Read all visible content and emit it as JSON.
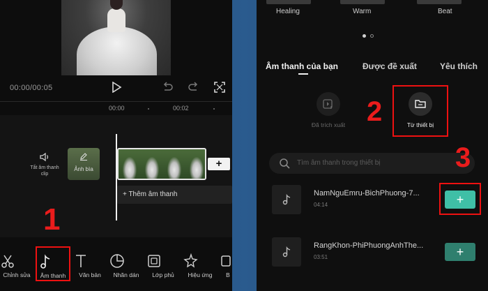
{
  "left": {
    "time": "00:00/00:05",
    "ruler": [
      "00:00",
      "00:02"
    ],
    "mute_label": "Tắt âm thanh clip",
    "cover_label": "Ảnh bìa",
    "add_clip": "+",
    "add_audio": "+ Thêm âm thanh",
    "tools": [
      {
        "label": "Chỉnh sửa",
        "icon": "scissors-icon"
      },
      {
        "label": "Âm thanh",
        "icon": "music-note-icon"
      },
      {
        "label": "Văn bản",
        "icon": "text-icon"
      },
      {
        "label": "Nhãn dán",
        "icon": "sticker-icon"
      },
      {
        "label": "Lớp phủ",
        "icon": "overlay-icon"
      },
      {
        "label": "Hiệu ứng",
        "icon": "effects-icon"
      },
      {
        "label": "B",
        "icon": "more-icon"
      }
    ]
  },
  "right": {
    "categories": [
      "Healing",
      "Warm",
      "Beat"
    ],
    "tabs": [
      "Âm thanh của bạn",
      "Được đề xuất",
      "Yêu thích"
    ],
    "sources": [
      {
        "label": "Đã trích xuất",
        "icon": "extract-video-icon"
      },
      {
        "label": "Từ thiết bị",
        "icon": "folder-icon"
      }
    ],
    "search_placeholder": "Tìm âm thanh trong thiết bị",
    "songs": [
      {
        "name": "NamNguEmru-BichPhuong-7...",
        "duration": "04:14",
        "add": "+"
      },
      {
        "name": "RangKhon-PhiPhuongAnhThe...",
        "duration": "03:51",
        "add": "+"
      }
    ]
  },
  "annotations": [
    "1",
    "2",
    "3"
  ],
  "colors": {
    "accent_red": "#e11111",
    "add_button": "#3fbfa6",
    "add_button_dim": "#2f7f6e"
  }
}
